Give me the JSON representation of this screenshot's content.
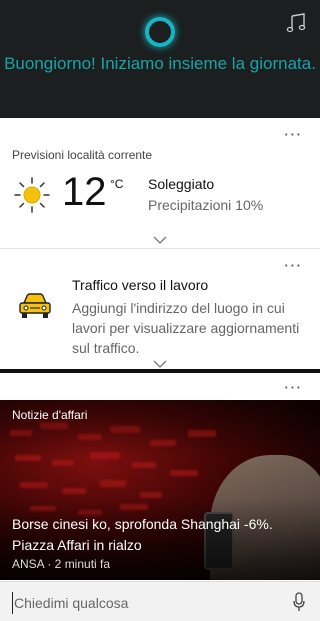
{
  "header": {
    "greeting": "Buongiorno! Iniziamo insieme la giornata.",
    "ring_color": "#1ab5c4",
    "greeting_color": "#18a3a8",
    "music_icon": "music-note-icon"
  },
  "weather": {
    "title": "Previsioni località corrente",
    "temperature": "12",
    "unit": "°C",
    "condition": "Soleggiato",
    "precipitation": "Precipitazioni 10%",
    "icon": "sun-icon",
    "more": "···"
  },
  "traffic": {
    "title": "Traffico verso il lavoro",
    "description": "Aggiungi l'indirizzo del luogo in cui lavori per visualizzare aggiornamenti sul traffico.",
    "icon": "car-icon",
    "more": "···"
  },
  "news": {
    "label": "Notizie d'affari",
    "headline": "Borse cinesi ko, sprofonda Shanghai -6%. Piazza Affari in rialzo",
    "source": "ANSA · 2 minuti fa",
    "more": "···"
  },
  "search": {
    "placeholder": "Chiedimi qualcosa",
    "mic_icon": "microphone-icon"
  }
}
